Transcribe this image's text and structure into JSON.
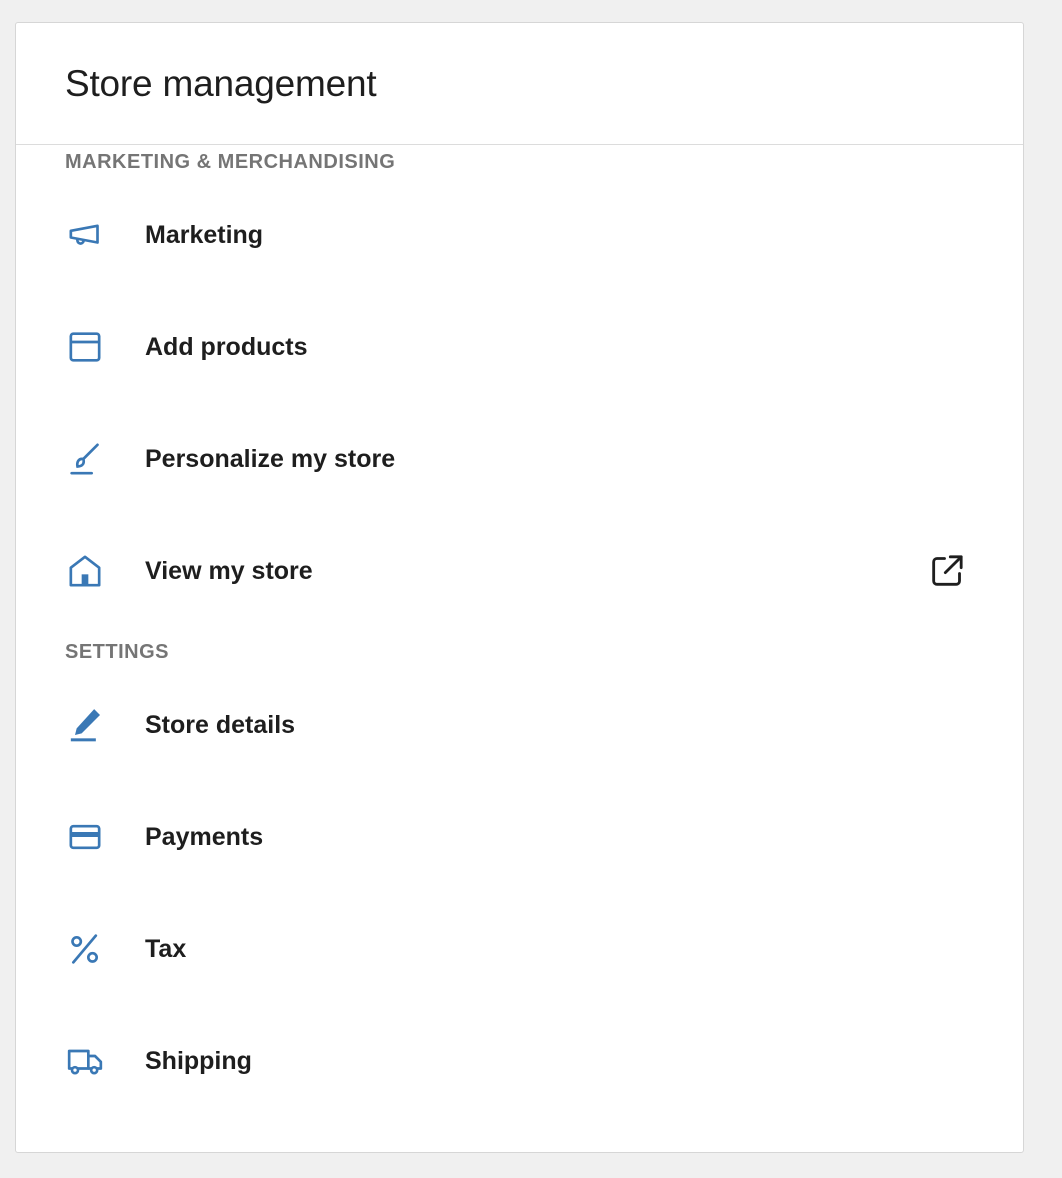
{
  "card": {
    "title": "Store management"
  },
  "colors": {
    "accent": "#3a78b5",
    "text": "#1e1e1e",
    "muted": "#757575",
    "background": "#f0f0f0"
  },
  "sections": [
    {
      "label": "MARKETING & MERCHANDISING",
      "items": [
        {
          "label": "Marketing",
          "icon": "megaphone-icon"
        },
        {
          "label": "Add products",
          "icon": "archive-box-icon"
        },
        {
          "label": "Personalize my store",
          "icon": "brush-icon"
        },
        {
          "label": "View my store",
          "icon": "store-icon",
          "trailing_icon": "external-link-icon"
        }
      ]
    },
    {
      "label": "SETTINGS",
      "items": [
        {
          "label": "Store details",
          "icon": "pencil-icon"
        },
        {
          "label": "Payments",
          "icon": "credit-card-icon"
        },
        {
          "label": "Tax",
          "icon": "percent-icon"
        },
        {
          "label": "Shipping",
          "icon": "truck-icon"
        }
      ]
    }
  ]
}
